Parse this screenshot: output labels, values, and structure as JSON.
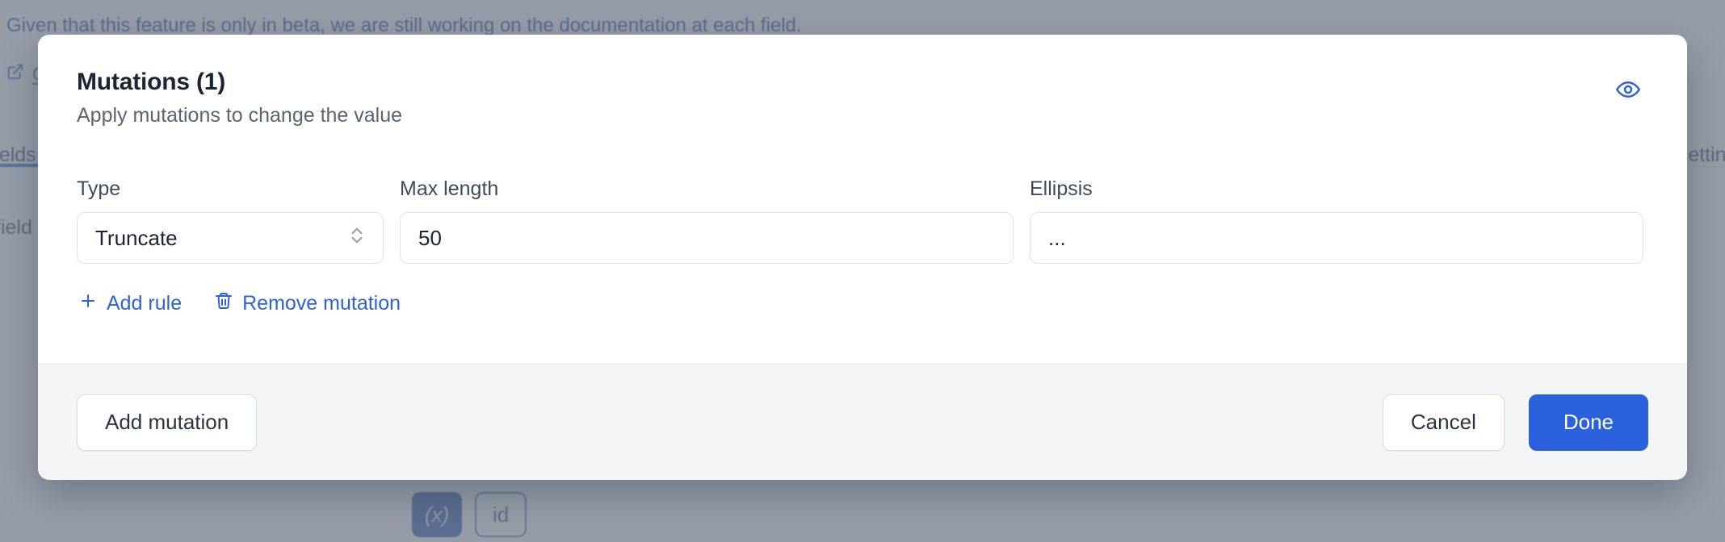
{
  "background": {
    "top_paragraph": "Given that this feature is only in beta, we are still working on the documentation at each field.",
    "link_row": {
      "icon": "external-link-icon",
      "label": "Open documentation"
    },
    "tabs": [
      {
        "label": "Fields",
        "active": true
      },
      {
        "label": "Settings",
        "active": false
      }
    ],
    "body_text": "field",
    "chips": [
      {
        "label": "(x)",
        "type": "function",
        "icon": "function-chip-icon"
      },
      {
        "label": "id",
        "type": "outline"
      }
    ]
  },
  "modal": {
    "title": "Mutations (1)",
    "subtitle": "Apply mutations to change the value",
    "preview_icon": "eye-icon",
    "fields": [
      {
        "label": "Type",
        "control": "select",
        "value": "Truncate",
        "icon": "chevron-updown-icon"
      },
      {
        "label": "Max length",
        "control": "input",
        "value": "50",
        "placeholder": ""
      },
      {
        "label": "Ellipsis",
        "control": "input",
        "value": "...",
        "placeholder": ""
      }
    ],
    "links": [
      {
        "label": "Add rule",
        "icon": "plus-icon"
      },
      {
        "label": "Remove mutation",
        "icon": "trash-icon"
      }
    ],
    "footer": {
      "add_mutation_label": "Add mutation",
      "cancel_label": "Cancel",
      "done_label": "Done"
    }
  },
  "colors": {
    "accent": "#2b61dd",
    "link": "#2f62d8",
    "title": "#1d2433",
    "muted": "#5b6472",
    "footer_bg": "#f3f5f7",
    "border": "#dfe3e9",
    "scrim": "#697484"
  }
}
